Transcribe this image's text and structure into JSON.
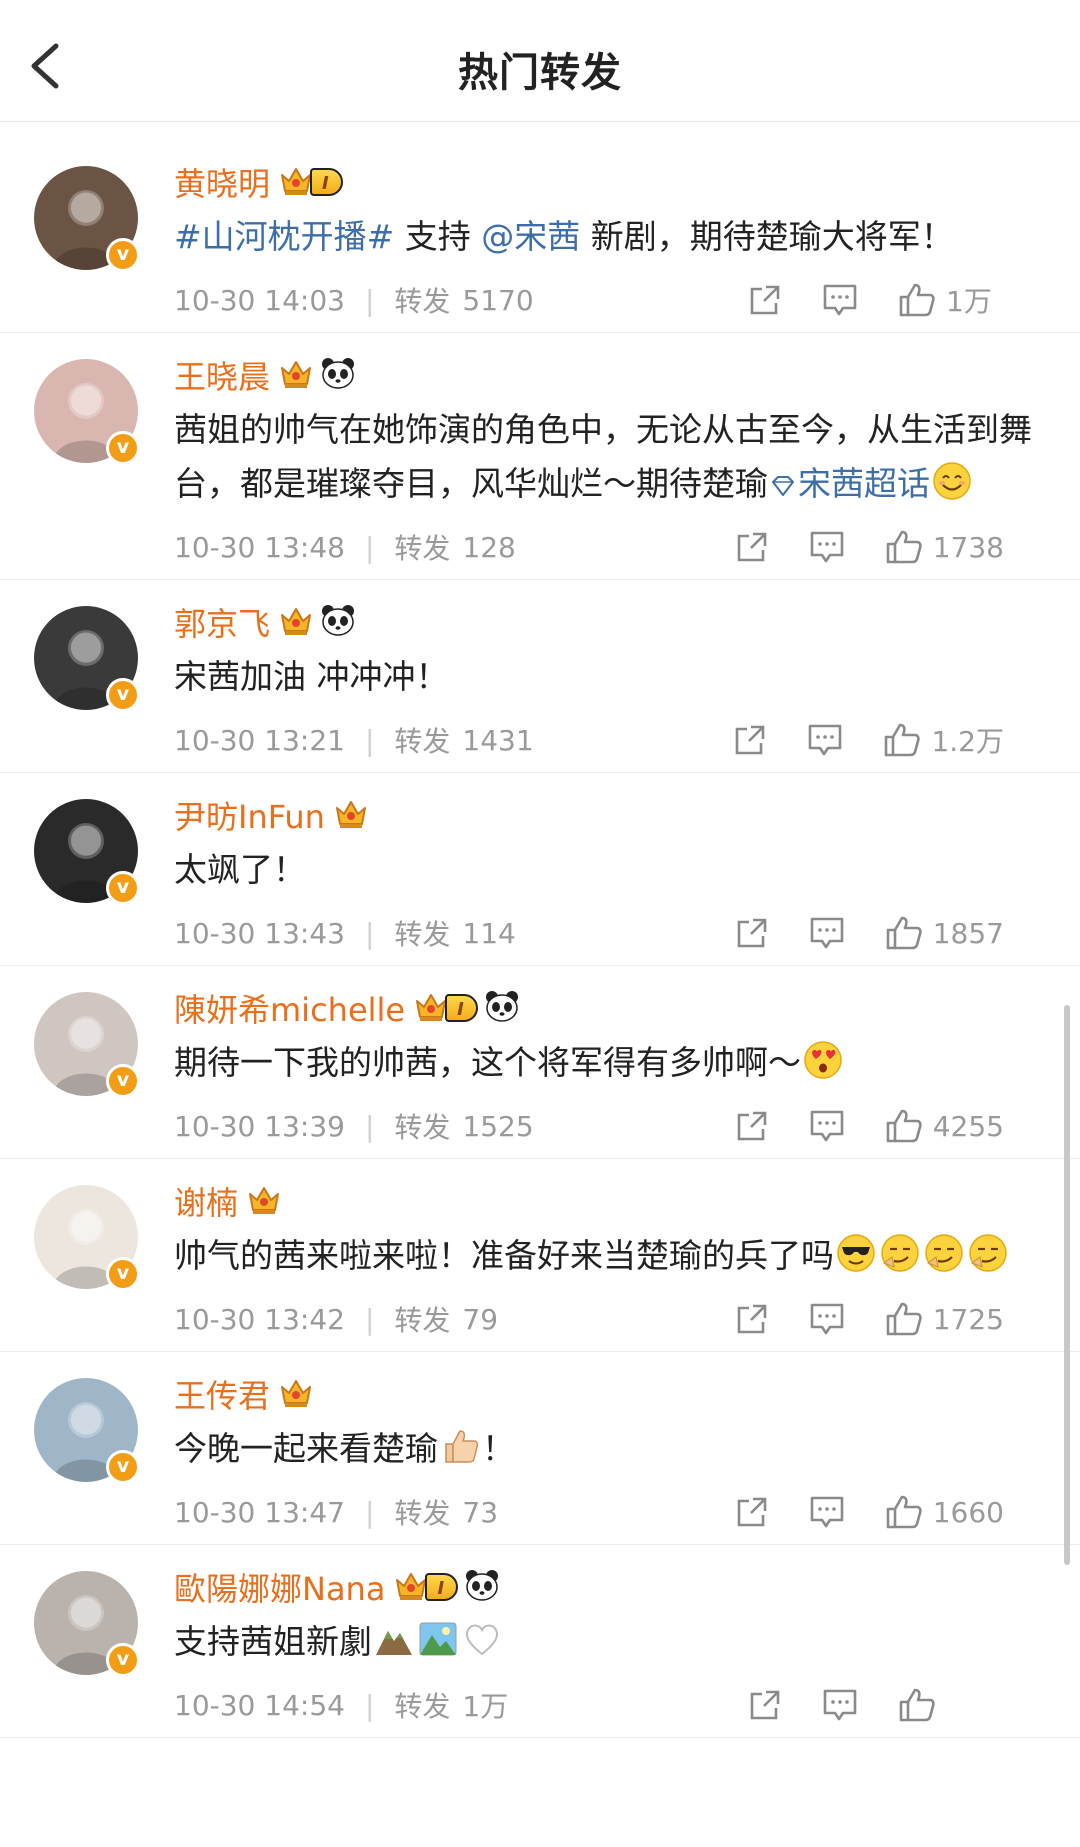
{
  "header": {
    "title": "热门转发"
  },
  "labels": {
    "repost": "转发"
  },
  "items": [
    {
      "name": "黄晓明",
      "crown": true,
      "level": "I",
      "panda": false,
      "avatar_color": "#6b5443",
      "segments": [
        {
          "t": "#山河枕开播#",
          "link": true
        },
        {
          "t": " 支持 "
        },
        {
          "t": "@宋茜",
          "link": true
        },
        {
          "t": " 新剧，期待楚瑜大将军！"
        }
      ],
      "time": "10-30 14:03",
      "repost": "5170",
      "likes": "1万"
    },
    {
      "name": "王晓晨",
      "crown": true,
      "level": "",
      "panda": true,
      "avatar_color": "#d9b7b0",
      "segments": [
        {
          "t": "茜姐的帅气在她饰演的角色中，无论从古至今，从生活到舞台，都是璀璨夺目，风华灿烂～期待楚瑜"
        },
        {
          "t": "宋茜超话",
          "link": true,
          "diamond": true
        },
        {
          "emoji": "smile-emoji"
        }
      ],
      "time": "10-30 13:48",
      "repost": "128",
      "likes": "1738"
    },
    {
      "name": "郭京飞",
      "crown": true,
      "level": "",
      "panda": true,
      "avatar_color": "#3a3a3a",
      "segments": [
        {
          "t": "宋茜加油 冲冲冲！"
        }
      ],
      "time": "10-30 13:21",
      "repost": "1431",
      "likes": "1.2万"
    },
    {
      "name": "尹昉InFun",
      "crown": true,
      "level": "",
      "panda": false,
      "avatar_color": "#2a2a2a",
      "segments": [
        {
          "t": "太飒了！"
        }
      ],
      "time": "10-30 13:43",
      "repost": "114",
      "likes": "1857"
    },
    {
      "name": "陳妍希michelle",
      "crown": true,
      "level": "I",
      "panda": true,
      "avatar_color": "#cfc6c2",
      "segments": [
        {
          "t": "期待一下我的帅茜，这个将军得有多帅啊～"
        },
        {
          "emoji": "heart-eyes-emoji"
        }
      ],
      "time": "10-30 13:39",
      "repost": "1525",
      "likes": "4255"
    },
    {
      "name": "谢楠",
      "crown": true,
      "level": "",
      "panda": false,
      "avatar_color": "#ede6df",
      "segments": [
        {
          "t": "帅气的茜来啦来啦！准备好来当楚瑜的兵了吗"
        },
        {
          "emoji": "cool-emoji"
        },
        {
          "emoji": "smirk-emoji"
        },
        {
          "emoji": "smirk-emoji"
        },
        {
          "emoji": "smirk-emoji"
        }
      ],
      "time": "10-30 13:42",
      "repost": "79",
      "likes": "1725"
    },
    {
      "name": "王传君",
      "crown": true,
      "level": "",
      "panda": false,
      "avatar_color": "#9fb6c9",
      "segments": [
        {
          "t": "今晚一起来看楚瑜"
        },
        {
          "emoji": "thumbs-up-emoji"
        },
        {
          "t": "！"
        }
      ],
      "time": "10-30 13:47",
      "repost": "73",
      "likes": "1660"
    },
    {
      "name": "歐陽娜娜Nana",
      "crown": true,
      "level": "I",
      "panda": true,
      "avatar_color": "#b9b2ad",
      "segments": [
        {
          "t": "支持茜姐新劇"
        },
        {
          "emoji": "mountain-emoji"
        },
        {
          "emoji": "landscape-emoji"
        },
        {
          "emoji": "white-heart-emoji"
        }
      ],
      "time": "10-30 14:54",
      "repost": "1万",
      "likes": ""
    }
  ]
}
